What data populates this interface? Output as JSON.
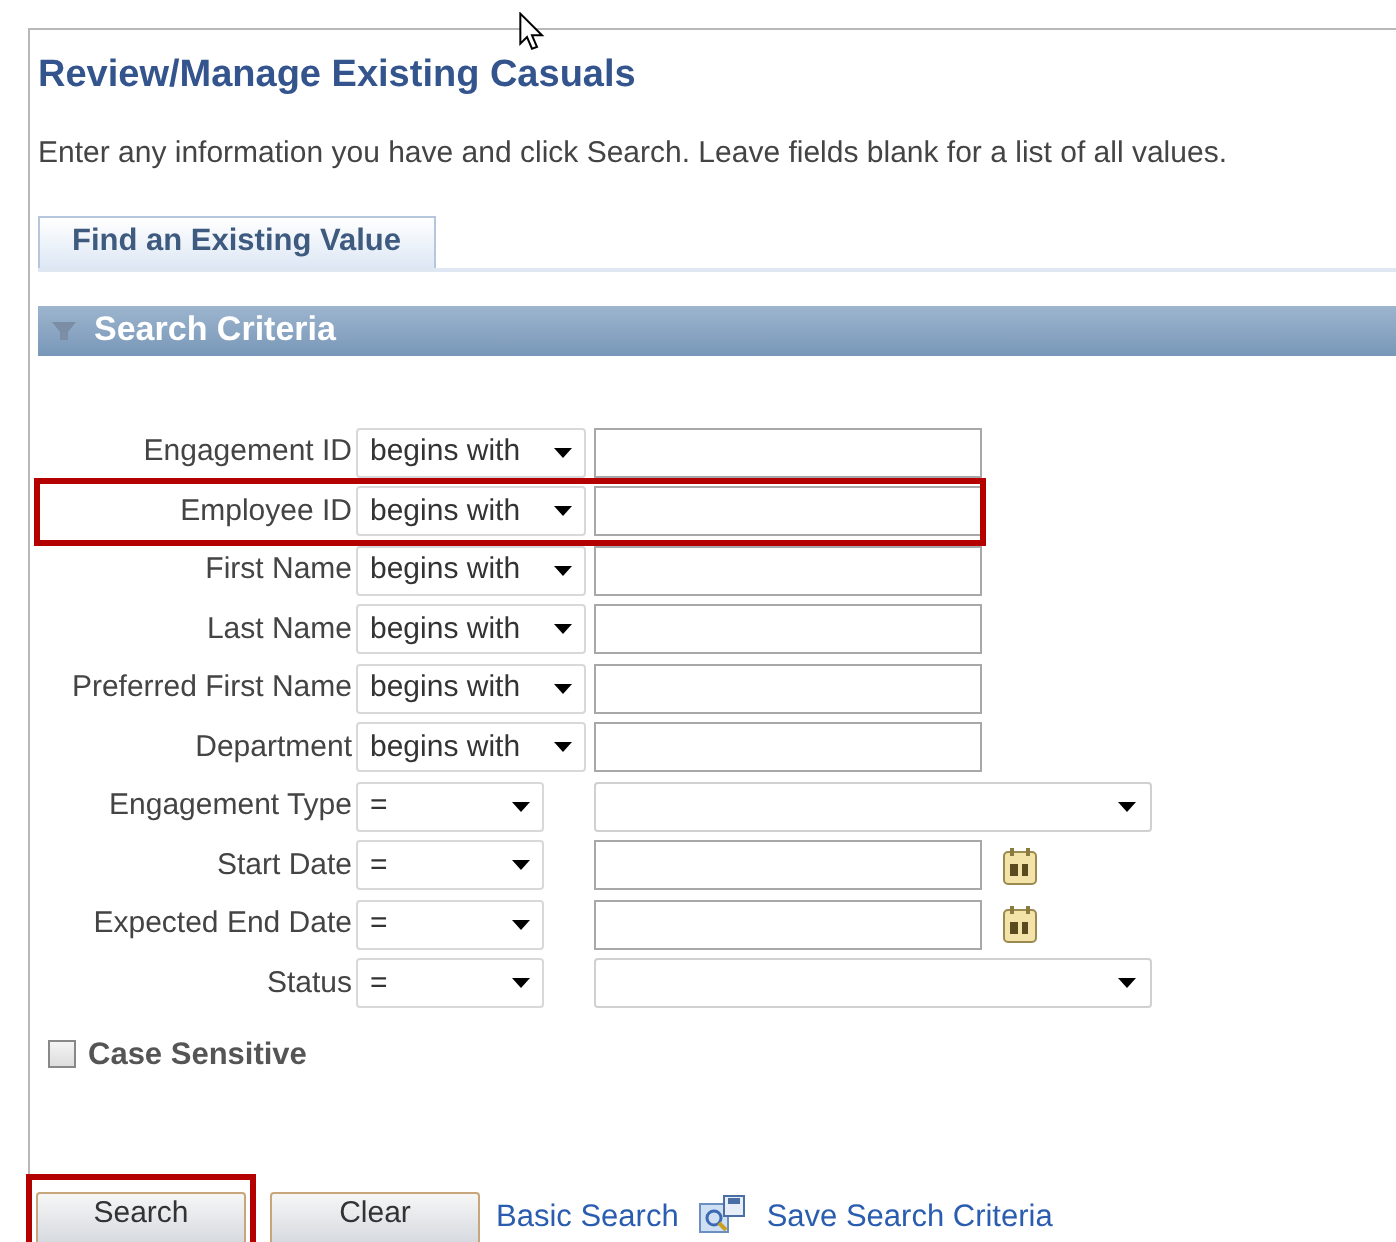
{
  "page_title": "Review/Manage Existing Casuals",
  "instructions": "Enter any information you have and click Search. Leave fields blank for a list of all values.",
  "tabs": [
    {
      "label": "Find an Existing Value",
      "selected": true
    }
  ],
  "section_title": "Search Criteria",
  "criteria": [
    {
      "kind": "text",
      "label": "Engagement ID",
      "operator": "begins with",
      "highlighted": false
    },
    {
      "kind": "text",
      "label": "Employee ID",
      "operator": "begins with",
      "highlighted": true
    },
    {
      "kind": "text",
      "label": "First Name",
      "operator": "begins with",
      "highlighted": false
    },
    {
      "kind": "text",
      "label": "Last Name",
      "operator": "begins with",
      "highlighted": false
    },
    {
      "kind": "text",
      "label": "Preferred First Name",
      "operator": "begins with",
      "highlighted": false
    },
    {
      "kind": "text",
      "label": "Department",
      "operator": "begins with",
      "highlighted": false
    },
    {
      "kind": "select",
      "label": "Engagement Type",
      "operator": "=",
      "highlighted": false
    },
    {
      "kind": "date",
      "label": "Start Date",
      "operator": "=",
      "highlighted": false
    },
    {
      "kind": "date",
      "label": "Expected End Date",
      "operator": "=",
      "highlighted": false
    },
    {
      "kind": "select",
      "label": "Status",
      "operator": "=",
      "highlighted": false
    }
  ],
  "case_sensitive": {
    "label": "Case Sensitive",
    "checked": false
  },
  "buttons": [
    {
      "label": "Search",
      "highlighted": true
    },
    {
      "label": "Clear",
      "highlighted": false
    }
  ],
  "links": [
    {
      "kind": "link",
      "label": "Basic Search"
    },
    {
      "kind": "save",
      "label": "Save Search Criteria"
    }
  ]
}
